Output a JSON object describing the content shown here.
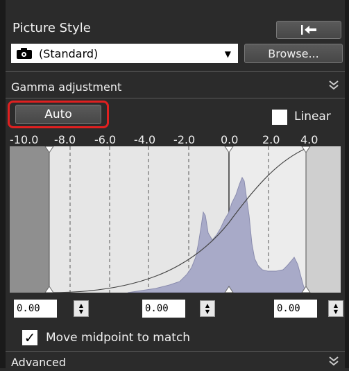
{
  "panel": {
    "title": "Picture Style",
    "revert_icon": "undo-arrow-icon",
    "style_select_value": "(Standard)",
    "browse_label": "Browse..."
  },
  "gamma": {
    "section_title": "Gamma adjustment",
    "collapse_icon": "double-chevron-down-icon",
    "auto_label": "Auto",
    "linear_label": "Linear",
    "linear_checked": false,
    "axis_ticks": [
      "-10.0",
      "-8.0",
      "-6.0",
      "-4.0",
      "-2.0",
      "0.0",
      "2.0",
      "4.0"
    ],
    "inputs": [
      "0.00",
      "0.00",
      "0.00"
    ],
    "move_midpoint_label": "Move midpoint to match",
    "move_midpoint_checked": true
  },
  "advanced": {
    "section_title": "Advanced"
  },
  "colors": {
    "highlight": "#e02020",
    "histogram": "#a8aac8",
    "panel_bg": "#2b2b2b"
  }
}
